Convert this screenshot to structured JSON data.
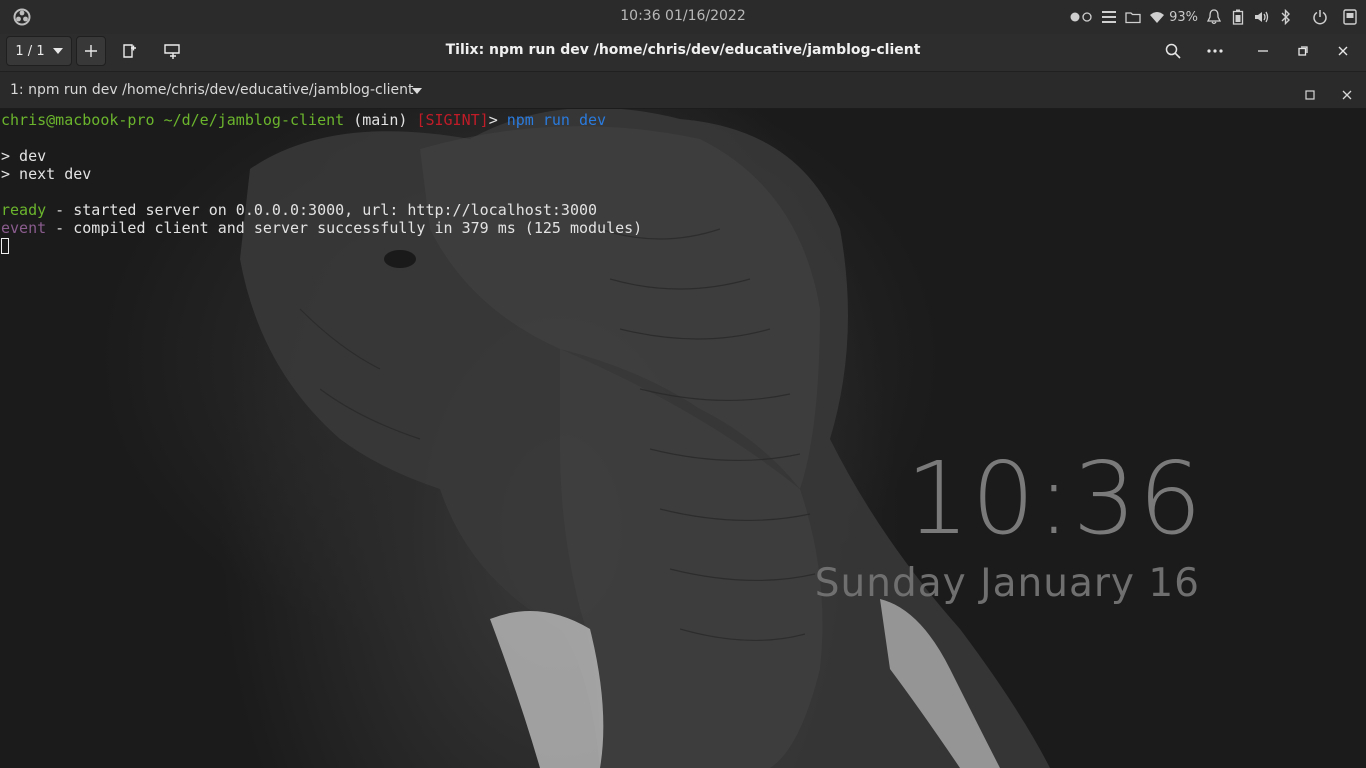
{
  "system_bar": {
    "datetime": "10:36 01/16/2022",
    "battery_percent": "93%",
    "icons": [
      "activities-icon",
      "workspace-indicator-icon",
      "menu-icon",
      "folder-icon",
      "wifi-icon",
      "notifications-icon",
      "battery-icon",
      "volume-icon",
      "bluetooth-icon",
      "power-icon",
      "screen-icon"
    ]
  },
  "header": {
    "session_switcher": "1 / 1",
    "title": "Tilix: npm run dev /home/chris/dev/educative/jamblog-client"
  },
  "terminal_tab": {
    "title": "1: npm run dev /home/chris/dev/educative/jamblog-client"
  },
  "terminal": {
    "prompt_user": "chris@macbook-pro",
    "prompt_path": "~/d/e/jamblog-client",
    "prompt_branch": "(main)",
    "prompt_signal": "[SIGINT]",
    "prompt_arrow": ">",
    "cmd_npm": "npm",
    "cmd_run": "run",
    "cmd_dev": "dev",
    "line_dev": "> dev",
    "line_next_dev": "> next dev",
    "ready_tag": "ready",
    "ready_msg": " - started server on 0.0.0.0:3000, url: http://localhost:3000",
    "event_tag": "event",
    "event_msg": " - compiled client and server successfully in 379 ms (125 modules)"
  },
  "wallpaper": {
    "time": "10:36",
    "date": "Sunday January 16"
  },
  "colors": {
    "green": "#6bb52d",
    "red": "#c01c28",
    "blue": "#2a7bde",
    "purple": "#8a5c8e"
  }
}
